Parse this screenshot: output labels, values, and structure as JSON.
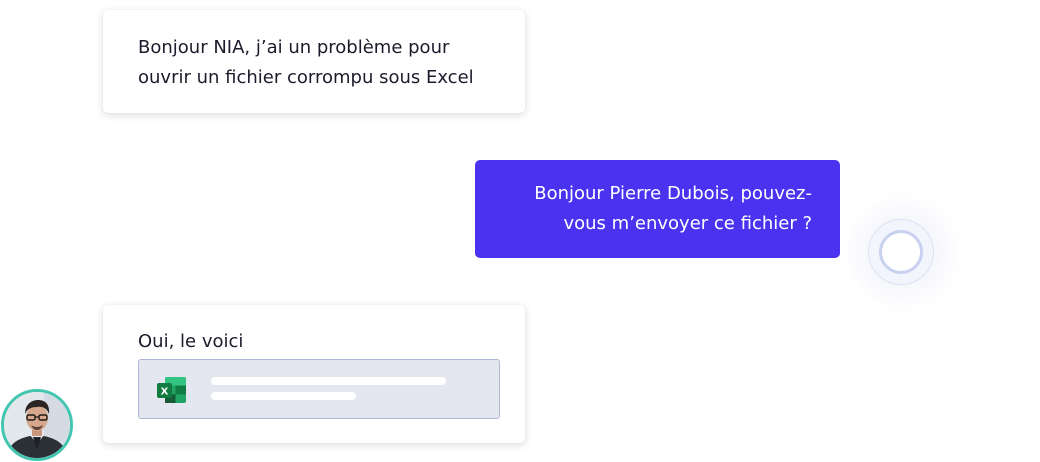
{
  "chat": {
    "messages": [
      {
        "sender": "user",
        "text": "Bonjour NIA, j’ai un problème pour\nouvrir un fichier corrompu sous Excel"
      },
      {
        "sender": "bot",
        "text": "Bonjour Pierre Dubois, pouvez-\nvous m’envoyer ce fichier ?"
      },
      {
        "sender": "user",
        "text": "Oui, le voici",
        "attachment": {
          "icon": "excel-icon"
        }
      }
    ]
  },
  "colors": {
    "bot_bubble": "#4a33f0",
    "user_bubble": "#ffffff",
    "text_dark": "#1b1b2b",
    "attachment_bg": "#e4e7ef",
    "attachment_border": "#aeb8d6",
    "avatar_ring": "#43c6b0",
    "excel_green": "#1f7a45"
  },
  "indicators": {
    "typing_icon": "loading-circle-icon",
    "user_avatar_icon": "user-avatar-photo"
  }
}
